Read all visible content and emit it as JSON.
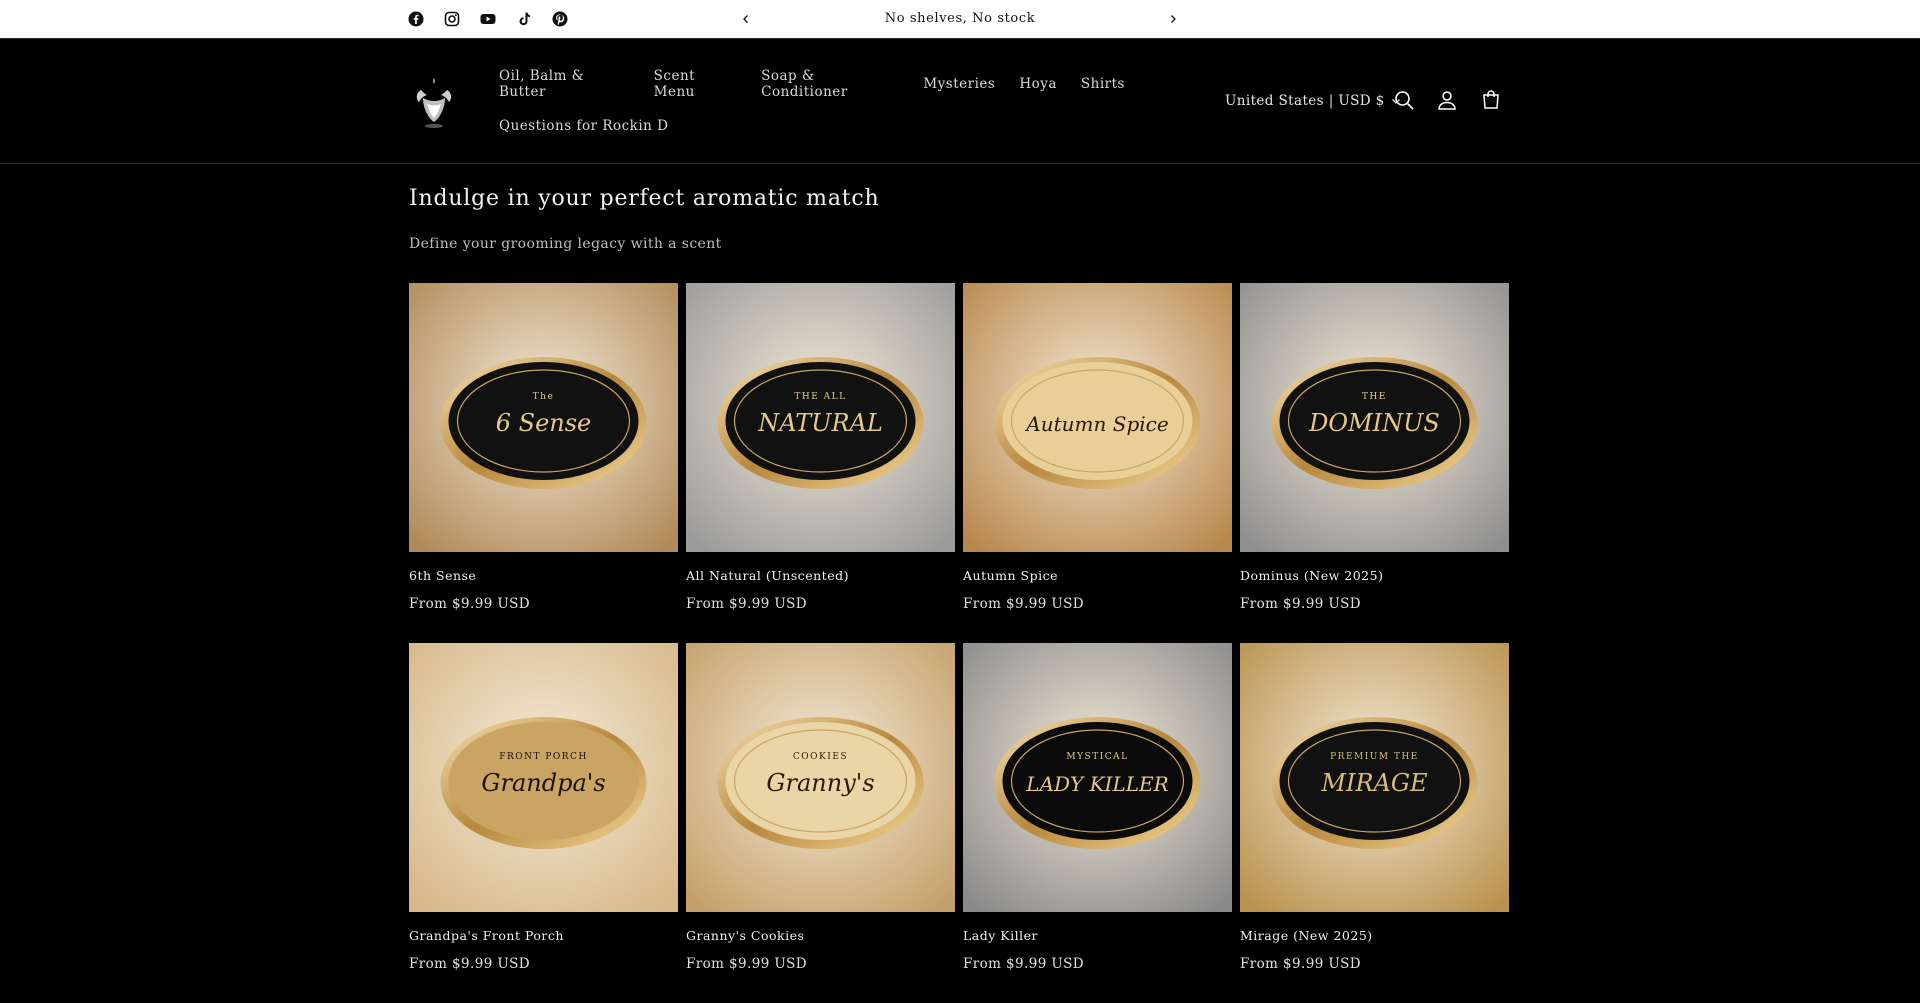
{
  "announcement": {
    "text": "No shelves, No stock"
  },
  "social": [
    "facebook-icon",
    "instagram-icon",
    "youtube-icon",
    "tiktok-icon",
    "pinterest-icon"
  ],
  "nav": {
    "row1": [
      "Oil, Balm & Butter",
      "Scent Menu",
      "Soap & Conditioner",
      "Mysteries",
      "Hoya",
      "Shirts"
    ],
    "row2": [
      "Questions for Rockin D"
    ]
  },
  "header": {
    "currency": "United States | USD $"
  },
  "collection": {
    "title": "Indulge in your perfect aromatic match",
    "description": "Define your grooming legacy with a scent"
  },
  "products": [
    {
      "title": "6th Sense",
      "price": "From $9.99 USD",
      "label": "6 Sense",
      "label_top": "The",
      "bg": "#b08a5a",
      "oval": "#111",
      "text_color": "#e6c98a"
    },
    {
      "title": "All Natural (Unscented)",
      "price": "From $9.99 USD",
      "label": "NATURAL",
      "label_top": "THE ALL",
      "bg": "#9a9a9a",
      "oval": "#111",
      "text_color": "#e6c98a"
    },
    {
      "title": "Autumn Spice",
      "price": "From $9.99 USD",
      "label": "Autumn Spice",
      "label_top": "",
      "bg": "#b8874d",
      "oval": "#e7cf97",
      "text_color": "#2a1a0a"
    },
    {
      "title": "Dominus (New 2025)",
      "price": "From $9.99 USD",
      "label": "DOMINUS",
      "label_top": "THE",
      "bg": "#8f8f8f",
      "oval": "#111",
      "text_color": "#e6c98a"
    },
    {
      "title": "Grandpa's Front Porch",
      "price": "From $9.99 USD",
      "label": "Grandpa's",
      "label_top": "FRONT PORCH",
      "bg": "#d6b889",
      "oval": "#c9a463",
      "text_color": "#1a1108"
    },
    {
      "title": "Granny's Cookies",
      "price": "From $9.99 USD",
      "label": "Granny's",
      "label_top": "COOKIES",
      "bg": "#c4a06a",
      "oval": "#ead5a6",
      "text_color": "#2a1a0a"
    },
    {
      "title": "Lady Killer",
      "price": "From $9.99 USD",
      "label": "LADY KILLER",
      "label_top": "MYSTICAL",
      "bg": "#8a8a8a",
      "oval": "#0b0b0b",
      "text_color": "#e6c98a"
    },
    {
      "title": "Mirage (New 2025)",
      "price": "From $9.99 USD",
      "label": "MIRAGE",
      "label_top": "PREMIUM THE",
      "bg": "#b9924f",
      "oval": "#111",
      "text_color": "#d9bc7a"
    }
  ]
}
